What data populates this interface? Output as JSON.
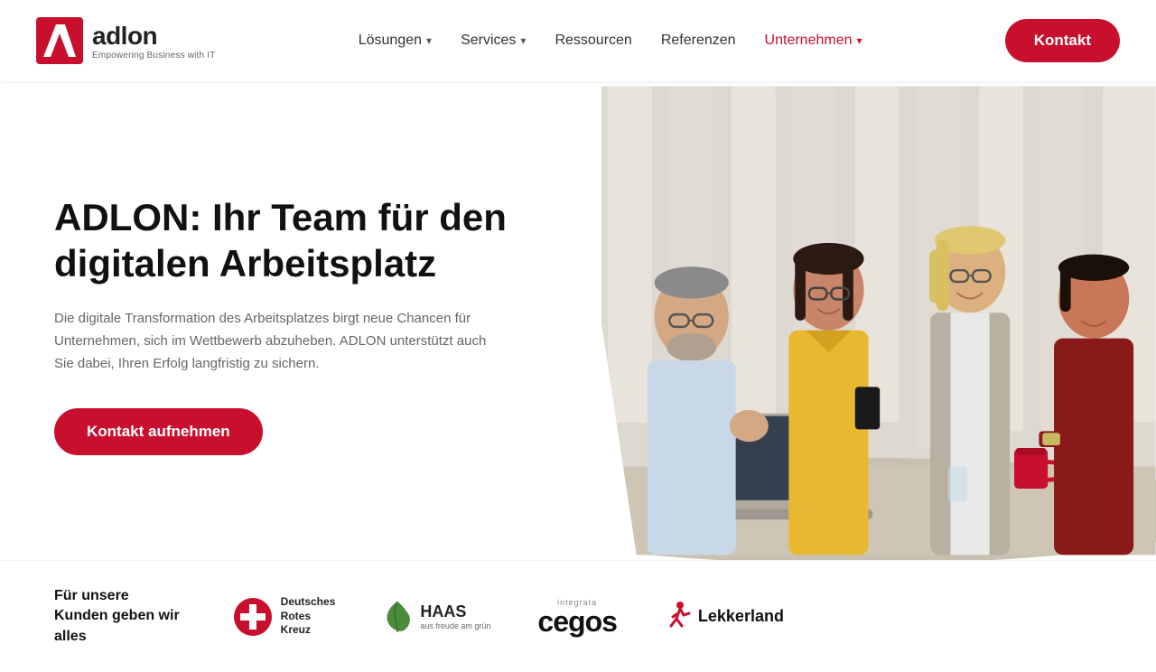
{
  "brand": {
    "name": "adlon",
    "tagline": "Empowering Business with IT",
    "logo_letter": "/"
  },
  "nav": {
    "links": [
      {
        "label": "Lösungen",
        "has_dropdown": true
      },
      {
        "label": "Services",
        "has_dropdown": true
      },
      {
        "label": "Ressourcen",
        "has_dropdown": false
      },
      {
        "label": "Referenzen",
        "has_dropdown": false
      },
      {
        "label": "Unternehmen",
        "has_dropdown": true,
        "active": true
      }
    ],
    "cta_label": "Kontakt"
  },
  "hero": {
    "title": "ADLON: Ihr Team für den digitalen Arbeitsplatz",
    "description": "Die digitale Transformation des Arbeitsplatzes birgt neue Chancen für Unternehmen, sich im Wettbewerb abzuheben. ADLON unterstützt auch Sie dabei, Ihren Erfolg langfristig zu sichern.",
    "cta_label": "Kontakt aufnehmen"
  },
  "clients": {
    "intro_line1": "Für unsere",
    "intro_line2": "Kunden geben wir",
    "intro_line3": "alles",
    "logos": [
      {
        "name": "Deutsches Rotes Kreuz",
        "type": "drk"
      },
      {
        "name": "HAAS",
        "subtitle": "aus freude am grün",
        "type": "haas"
      },
      {
        "name": "cegos",
        "prefix": "integrata",
        "type": "cegos"
      },
      {
        "name": "Lekkerland",
        "type": "lekkerland"
      }
    ]
  },
  "colors": {
    "accent": "#c8102e",
    "text_dark": "#111111",
    "text_mid": "#333333",
    "text_light": "#666666"
  }
}
